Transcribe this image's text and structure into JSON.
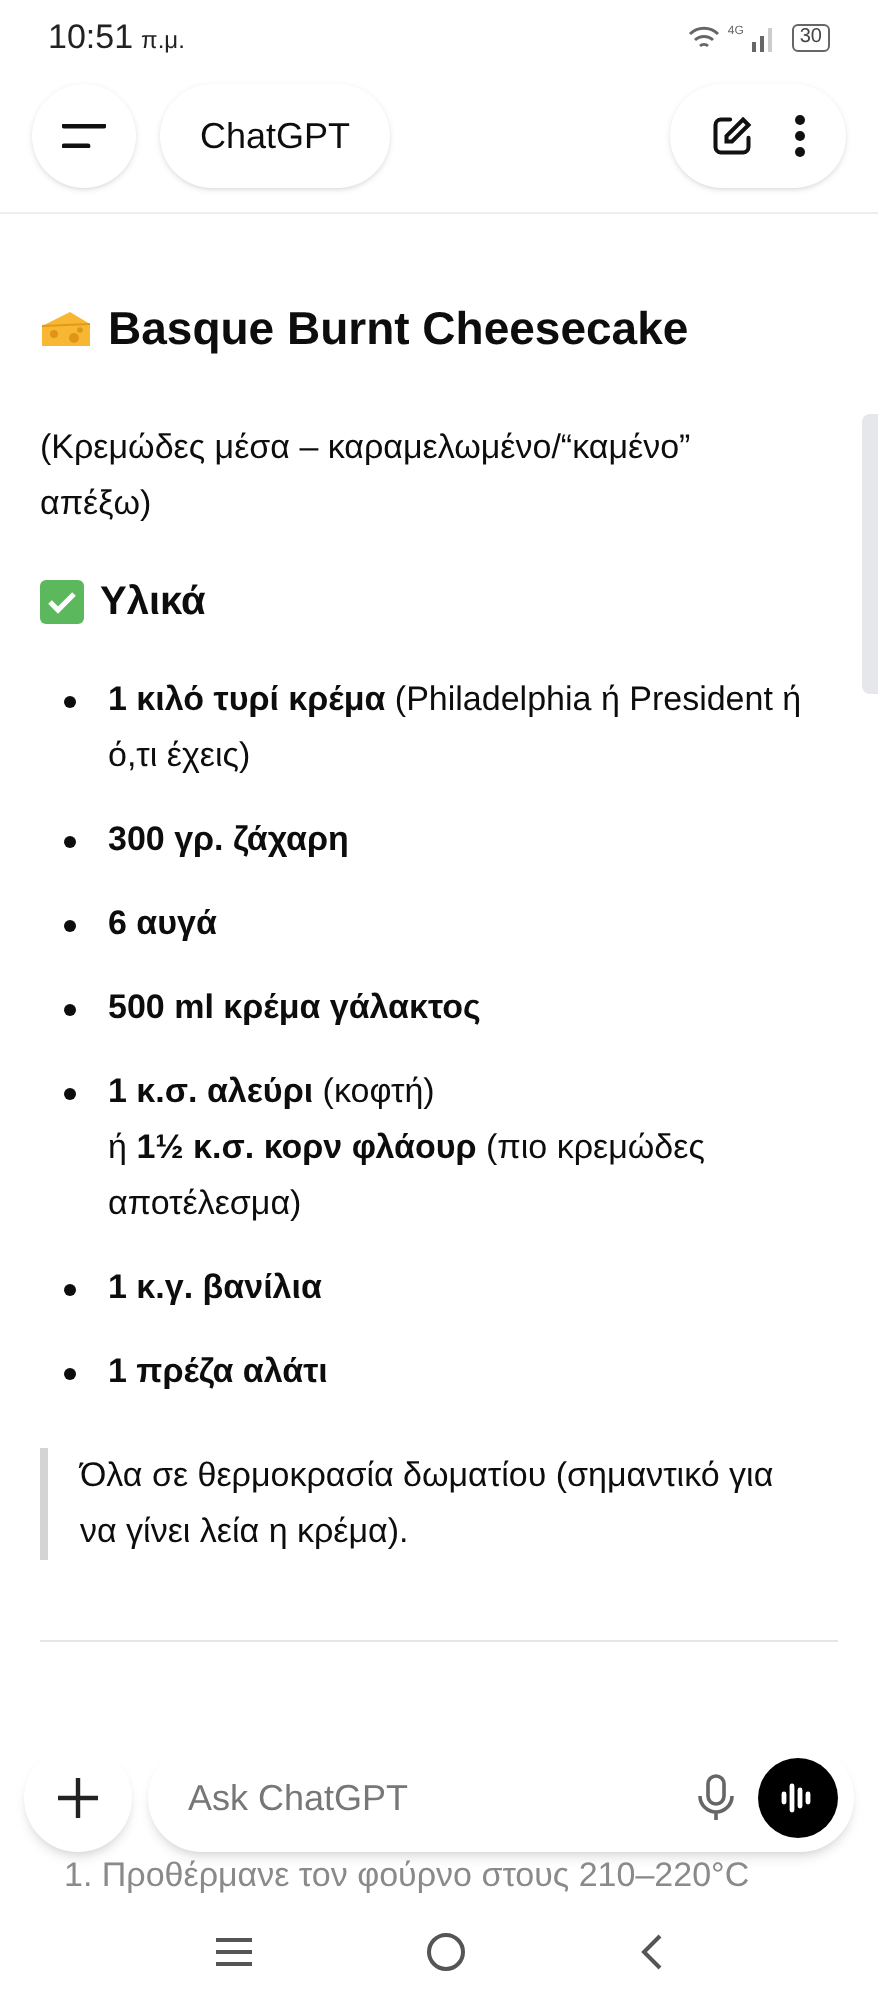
{
  "status_bar": {
    "time": "10:51",
    "ampm": "π.μ.",
    "network": "4G",
    "battery": "30"
  },
  "header": {
    "title": "ChatGPT"
  },
  "message": {
    "title": "Basque Burnt Cheesecake",
    "subtitle": "(Κρεμώδες μέσα – καραμελωμένο/“καμένο” απέξω)",
    "section": "Υλικά",
    "ingredients": [
      {
        "text": "**1 κιλό τυρί κρέμα** (Philadelphia ή President ή ό,τι έχεις)"
      },
      {
        "text": "**300 γρ. ζάχαρη**"
      },
      {
        "text": "**6 αυγά**"
      },
      {
        "text": "**500 ml κρέμα γάλακτος**"
      },
      {
        "text": "**1 κ.σ. αλεύρι** (κοφτή)",
        "second": "ή **1½ κ.σ. κορν φλάουρ** (πιο κρεμώδες αποτέλεσμα)"
      },
      {
        "text": "**1 κ.γ. βανίλια**"
      },
      {
        "text": "**1 πρέζα αλάτι**"
      }
    ],
    "note": "Όλα σε θερμοκρασία δωματίου (σημαντικό για να γίνει λεία η κρέμα).",
    "next_step": "1. Προθέρμανε τον φούρνο στους 210–220°C"
  },
  "composer": {
    "placeholder": "Ask ChatGPT"
  }
}
